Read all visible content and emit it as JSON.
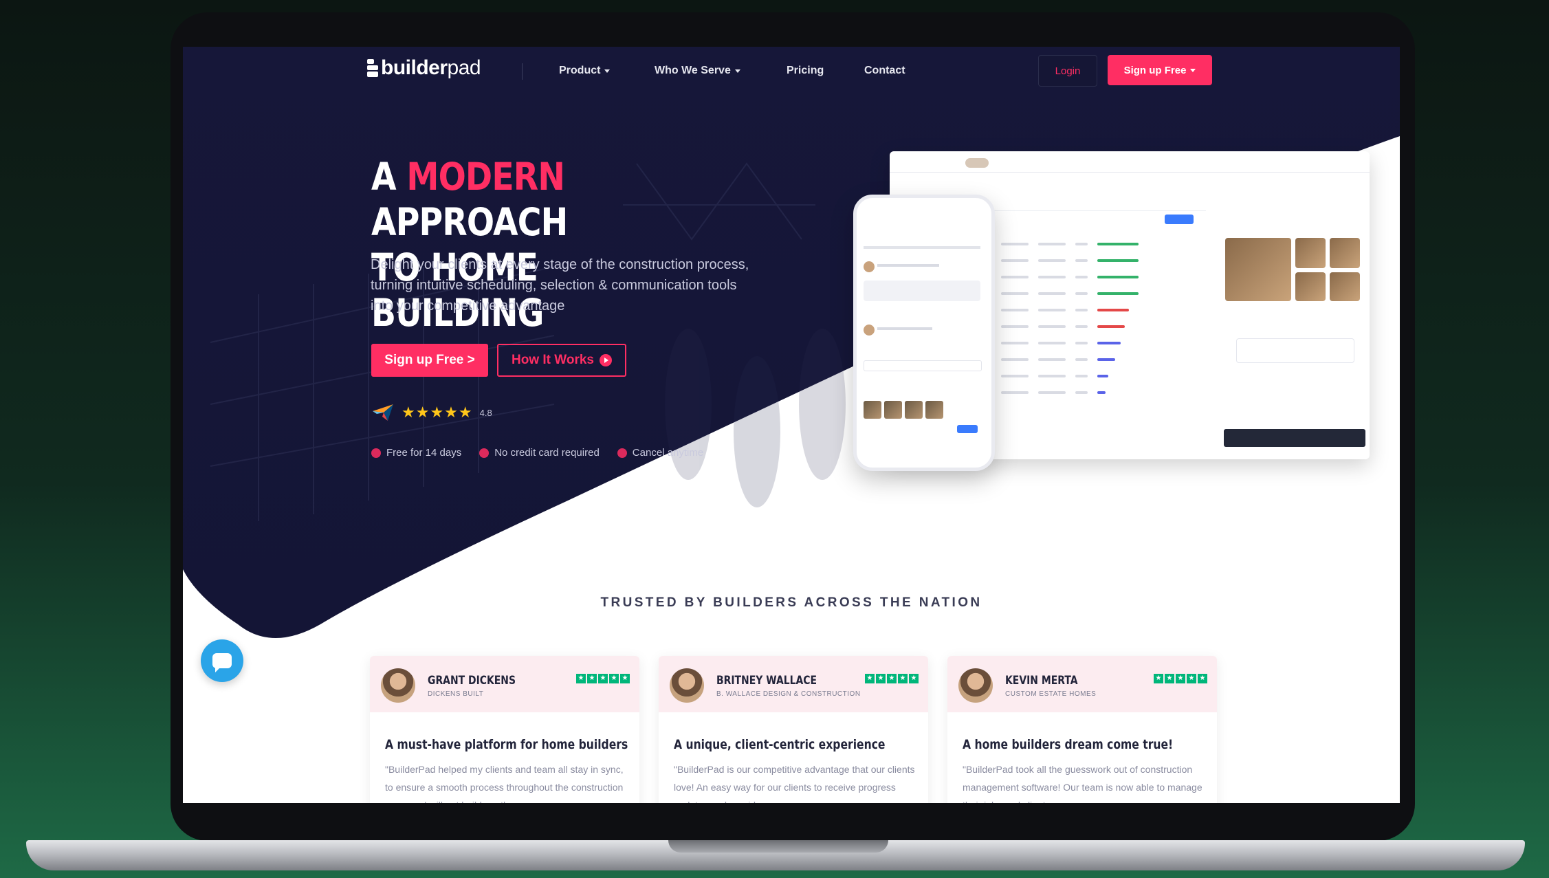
{
  "nav": {
    "logo_bold": "builder",
    "logo_light": "pad",
    "links": [
      {
        "label": "Product",
        "has_caret": true
      },
      {
        "label": "Who We Serve",
        "has_caret": true
      },
      {
        "label": "Pricing",
        "has_caret": false
      },
      {
        "label": "Contact",
        "has_caret": false
      }
    ],
    "login_label": "Login",
    "signup_label": "Sign up Free"
  },
  "hero": {
    "title_prefix": "A ",
    "title_accent": "MODERN",
    "title_rest1": " APPROACH",
    "title_line2": "TO HOME BUILDING",
    "subtitle": "Delight your clients at every stage of the construction process, turning intuitive scheduling, selection & communication tools into your competitive advantage",
    "cta_primary": "Sign up Free >",
    "cta_secondary": "How It Works",
    "stars": "★★★★★",
    "rating_value": "4.8",
    "perks": [
      "Free for 14 days",
      "No credit card required",
      "Cancel anytime"
    ]
  },
  "trusted_heading": "TRUSTED BY BUILDERS ACROSS THE NATION",
  "reviews": [
    {
      "name": "GRANT DICKENS",
      "company": "DICKENS BUILT",
      "title": "A must-have platform for home builders",
      "body": "\"BuilderPad helped my clients and team all stay in sync, to ensure a smooth process throughout the construction process. I will not build another"
    },
    {
      "name": "BRITNEY WALLACE",
      "company": "B. WALLACE DESIGN & CONSTRUCTION",
      "title": "A unique, client-centric experience",
      "body": "\"BuilderPad is our competitive advantage that our clients love! An easy way for our clients to receive progress updates and provide"
    },
    {
      "name": "KEVIN MERTA",
      "company": "CUSTOM ESTATE HOMES",
      "title": "A home builders dream come true!",
      "body": "\"BuilderPad took all the guesswork out of construction management software! Our team is now able to manage their jobs and clients"
    }
  ],
  "review_stars": "★",
  "colors": {
    "navy": "#15163a",
    "accent": "#ff2e63",
    "star": "#ffc61a",
    "trustpilot": "#00b67a",
    "chat": "#2aa4e8"
  },
  "icons": {
    "chat": "chat-bubble-icon",
    "rating_logo": "capterra-arrow-icon",
    "play": "play-circle-icon"
  }
}
